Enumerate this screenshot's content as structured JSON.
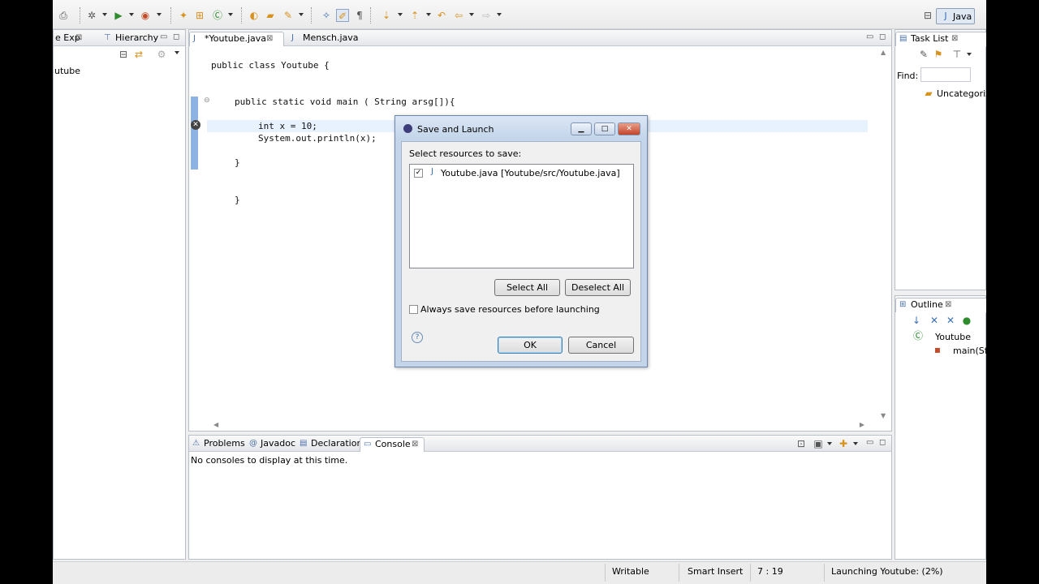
{
  "left_panel": {
    "tabs": [
      {
        "label": "e Exp"
      },
      {
        "label": "Hierarchy"
      }
    ],
    "tree_item": "utube"
  },
  "editor": {
    "tabs": [
      {
        "label": "*Youtube.java"
      },
      {
        "label": "Mensch.java"
      }
    ],
    "code": [
      "public class Youtube {",
      "public static void main ( String arsg[]){",
      "int x = 10;",
      "System.out.println(x);",
      "}",
      "}"
    ]
  },
  "console": {
    "tabs": [
      {
        "label": "Problems"
      },
      {
        "label": "Javadoc"
      },
      {
        "label": "Declaration"
      },
      {
        "label": "Console"
      }
    ],
    "message": "No consoles to display at this time."
  },
  "task_list": {
    "tab": "Task List",
    "find_label": "Find:",
    "category": "Uncategoriz"
  },
  "outline": {
    "tab": "Outline",
    "class_name": "Youtube",
    "method": "main(Str"
  },
  "perspective": {
    "label": "Java"
  },
  "status_bar": {
    "writable": "Writable",
    "insert_mode": "Smart Insert",
    "position": "7 : 19",
    "progress": "Launching Youtube: (2%)"
  },
  "dialog": {
    "title": "Save and Launch",
    "prompt": "Select resources to save:",
    "resource": {
      "name": "Youtube.java",
      "path": "[Youtube/src/Youtube.java]",
      "checked": true
    },
    "select_all": "Select All",
    "deselect_all": "Deselect All",
    "always_save": "Always save resources before launching",
    "ok": "OK",
    "cancel": "Cancel"
  },
  "colors": {
    "current_line": "#e8f2fe",
    "dialog_frame": "#c4d5ea",
    "accent": "#3a6fb5"
  }
}
